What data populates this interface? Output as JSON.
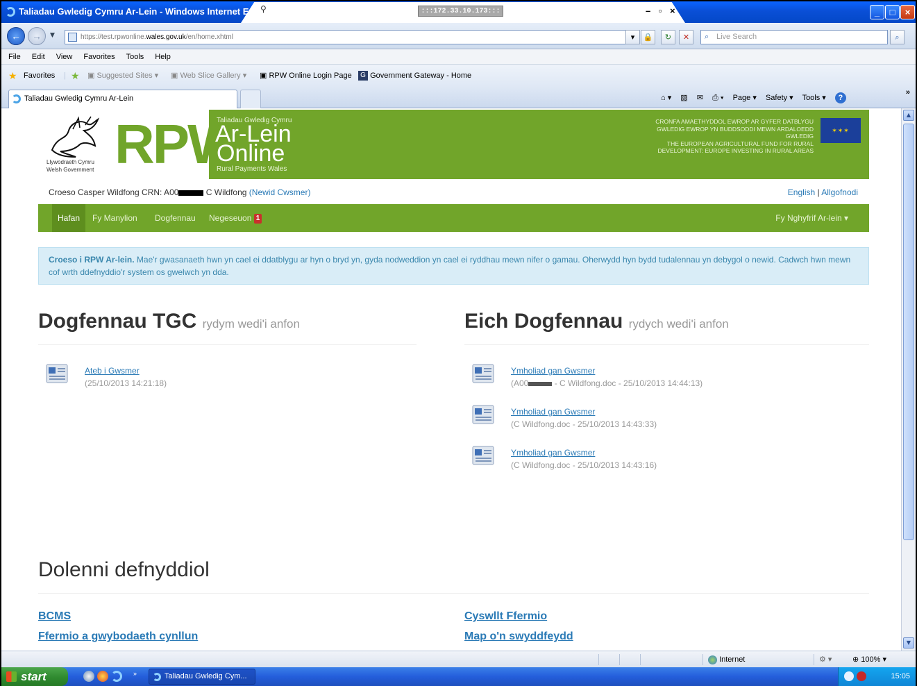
{
  "window": {
    "title": "Taliadau Gwledig Cymru Ar-Lein - Windows Internet Explorer",
    "remote_ip": ":::172.33.10.173:::",
    "minimize": "_",
    "maximize": "□",
    "close": "×"
  },
  "addressbar": {
    "url_prefix": "https://test.rpwonline.",
    "url_domain": "wales.gov.uk",
    "url_path": "/en/home.xhtml",
    "search_placeholder": "Live Search"
  },
  "menubar": [
    "File",
    "Edit",
    "View",
    "Favorites",
    "Tools",
    "Help"
  ],
  "favorites": {
    "label": "Favorites",
    "items": [
      "Suggested Sites ▾",
      "Web Slice Gallery ▾",
      "RPW Online Login Page",
      "Government Gateway - Home"
    ]
  },
  "tab": {
    "title": "Taliadau Gwledig Cymru Ar-Lein"
  },
  "commandbar": [
    "Page ▾",
    "Safety ▾",
    "Tools ▾"
  ],
  "banner": {
    "gov_line1": "Llywodraeth Cymru",
    "gov_line2": "Welsh Government",
    "rpw": "RPW",
    "sub_top": "Taliadau Gwledig Cymru",
    "ar_lein": "Ar-Lein",
    "online": "Online",
    "sub_bottom": "Rural Payments Wales",
    "eu_cy": "CRONFA AMAETHYDDOL EWROP AR GYFER DATBLYGU GWLEDIG EWROP YN BUDDSODDI MEWN ARDALOEDD GWLEDIG",
    "eu_en": "THE EUROPEAN AGRICULTURAL FUND FOR RURAL DEVELOPMENT: EUROPE INVESTING IN RURAL AREAS"
  },
  "userbar": {
    "welcome_prefix": "Croeso Casper Wildfong CRN: A00",
    "welcome_suffix": " C Wildfong ",
    "change_customer": "(Newid Cwsmer)",
    "english": "English",
    "separator": " | ",
    "logout": "Allgofnodi"
  },
  "nav": {
    "home": "Hafan",
    "details": "Fy Manylion",
    "documents": "Dogfennau",
    "messages": "Negeseuon",
    "messages_count": "1",
    "account": "Fy Nghyfrif Ar-lein ▾"
  },
  "alert": {
    "strong": "Croeso i RPW Ar-lein.",
    "text": " Mae'r gwasanaeth hwn yn cael ei ddatblygu ar hyn o bryd yn, gyda nodweddion yn cael ei ryddhau mewn nifer o gamau. Oherwydd hyn bydd tudalennau yn debygol o newid. Cadwch hwn mewn cof wrth ddefnyddio'r system os gwelwch yn dda."
  },
  "sent_docs": {
    "title": "Dogfennau TGC",
    "subtitle": "rydym wedi'i anfon",
    "items": [
      {
        "name": "Ateb i Gwsmer",
        "meta": "(25/10/2013 14:21:18)"
      }
    ]
  },
  "your_docs": {
    "title": "Eich Dogfennau",
    "subtitle": "rydych wedi'i anfon",
    "items": [
      {
        "name": "Ymholiad gan Gwsmer",
        "meta_prefix": "(A00",
        "meta": " - C Wildfong.doc - 25/10/2013 14:44:13)"
      },
      {
        "name": "Ymholiad gan Gwsmer",
        "meta": "(C Wildfong.doc - 25/10/2013 14:43:33)"
      },
      {
        "name": "Ymholiad gan Gwsmer",
        "meta": "(C Wildfong.doc - 25/10/2013 14:43:16)"
      }
    ]
  },
  "useful_links": {
    "title": "Dolenni defnyddiol",
    "left": [
      "BCMS",
      "Ffermio a gwybodaeth cynllun"
    ],
    "right": [
      "Cyswllt Ffermio",
      "Map o'n swyddfeydd"
    ]
  },
  "statusbar": {
    "zone": "Internet",
    "zoom": "100%"
  },
  "taskbar": {
    "start": "start",
    "task": "Taliadau Gwledig Cym...",
    "time": "15:05"
  },
  "colors": {
    "rpw_green": "#71a52a",
    "link_blue": "#2a7ab6",
    "alert_bg": "#d9edf7"
  }
}
